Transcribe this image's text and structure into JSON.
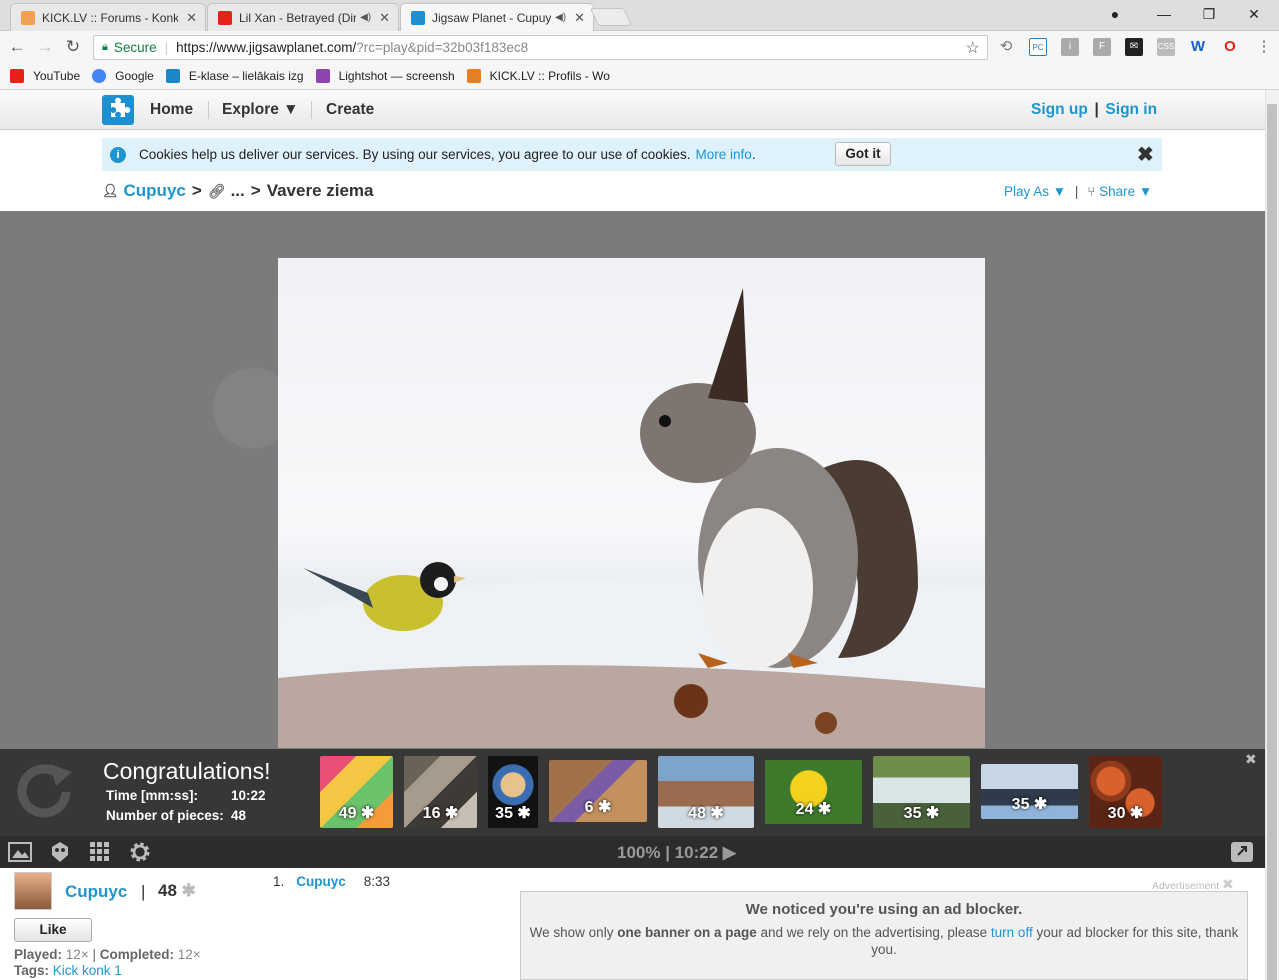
{
  "browser": {
    "tabs": [
      {
        "title": "KICK.LV :: Forums - Konk",
        "active": false,
        "audio": false
      },
      {
        "title": "Lil Xan - Betrayed (Dir",
        "active": false,
        "audio": true
      },
      {
        "title": "Jigsaw Planet - Cupuy",
        "active": true,
        "audio": true
      }
    ],
    "secure_label": "Secure",
    "url_host": "https://www.jigsawplanet.com/",
    "url_query": "?rc=play&pid=32b03f183ec8",
    "bookmarks": [
      {
        "label": "YouTube",
        "color": "#e62117"
      },
      {
        "label": "Google",
        "color": "#4285f4"
      },
      {
        "label": "E-klase – lielākais izg",
        "color": "#1c88c7"
      },
      {
        "label": "Lightshot — screensh",
        "color": "#8e44ad"
      },
      {
        "label": "KICK.LV :: Profils - Wo",
        "color": "#e67e22"
      }
    ]
  },
  "site": {
    "nav": {
      "home": "Home",
      "explore": "Explore ▼",
      "create": "Create"
    },
    "auth": {
      "signup": "Sign up",
      "divider": "|",
      "signin": "Sign in"
    },
    "cookie": {
      "text": "Cookies help us deliver our services. By using our services, you agree to our use of cookies.",
      "more": "More info",
      "button": "Got it"
    },
    "breadcrumb": {
      "user": "Cupuyc",
      "sep1": ">",
      "dots": "...",
      "sep2": ">",
      "title": "Vavere ziema"
    },
    "play_as": "Play As ▼",
    "share": "Share ▼",
    "pipe": "|"
  },
  "game": {
    "congrats_title": "Congratulations!",
    "time_label": "Time [mm:ss]:",
    "time_value": "10:22",
    "pieces_label": "Number of pieces:",
    "pieces_value": "48",
    "zoom_time": "100% | 10:22 ▶",
    "suggestions": [
      {
        "pieces": "49",
        "colors": [
          "#e94e77",
          "#f6c744",
          "#6ac26a",
          "#f59b3a"
        ]
      },
      {
        "pieces": "16",
        "colors": [
          "#6b6257",
          "#a69b8d",
          "#3e3a35",
          "#c7bfb3"
        ]
      },
      {
        "pieces": "35",
        "colors": [
          "#121212",
          "#3b6db3",
          "#e7c38a",
          "#1b1b1b"
        ]
      },
      {
        "pieces": "6",
        "colors": [
          "#a0714b",
          "#8b5a36",
          "#7a5ba6",
          "#c3905f"
        ]
      },
      {
        "pieces": "48",
        "colors": [
          "#7da4c9",
          "#9b6b50",
          "#cfd9e2",
          "#4f3c32"
        ]
      },
      {
        "pieces": "24",
        "colors": [
          "#3f7a2c",
          "#f2d21c",
          "#6fa242",
          "#e8b40f"
        ]
      },
      {
        "pieces": "35",
        "colors": [
          "#6e8c4a",
          "#d8e4e6",
          "#9fb38a",
          "#48613a"
        ]
      },
      {
        "pieces": "35",
        "colors": [
          "#8fb3d9",
          "#2f3a4a",
          "#c6d6e6",
          "#5d6e86"
        ]
      },
      {
        "pieces": "30",
        "colors": [
          "#8e3a1c",
          "#d8612e",
          "#f0c79a",
          "#5a2514"
        ]
      }
    ]
  },
  "info": {
    "author": "Cupuyc",
    "divider": "|",
    "pieces": "48",
    "like": "Like",
    "played_label": "Played:",
    "played_value": "12×",
    "completed_label": "Completed:",
    "completed_value": "12×",
    "tags_label": "Tags:",
    "tag": "Kick konk 1"
  },
  "leaderboard": [
    {
      "rank": "1.",
      "user": "Cupuyc",
      "time": "8:33"
    }
  ],
  "ad": {
    "label": "Advertisement",
    "heading": "We noticed you're using an ad blocker.",
    "text_a": "We show only",
    "text_b": "one banner on a page",
    "text_c": "and we rely on the advertising, please",
    "link": "turn off",
    "text_d": "your ad blocker for this site, thank you."
  }
}
